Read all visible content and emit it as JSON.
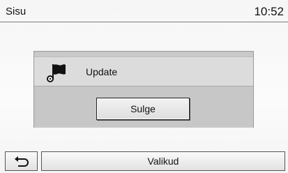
{
  "header": {
    "title": "Sisu",
    "clock": "10:52"
  },
  "dialog": {
    "icon": "flag-icon",
    "message": "Update",
    "close_label": "Sulge"
  },
  "footer": {
    "back_icon": "back-arrow-icon",
    "options_label": "Valikud"
  }
}
